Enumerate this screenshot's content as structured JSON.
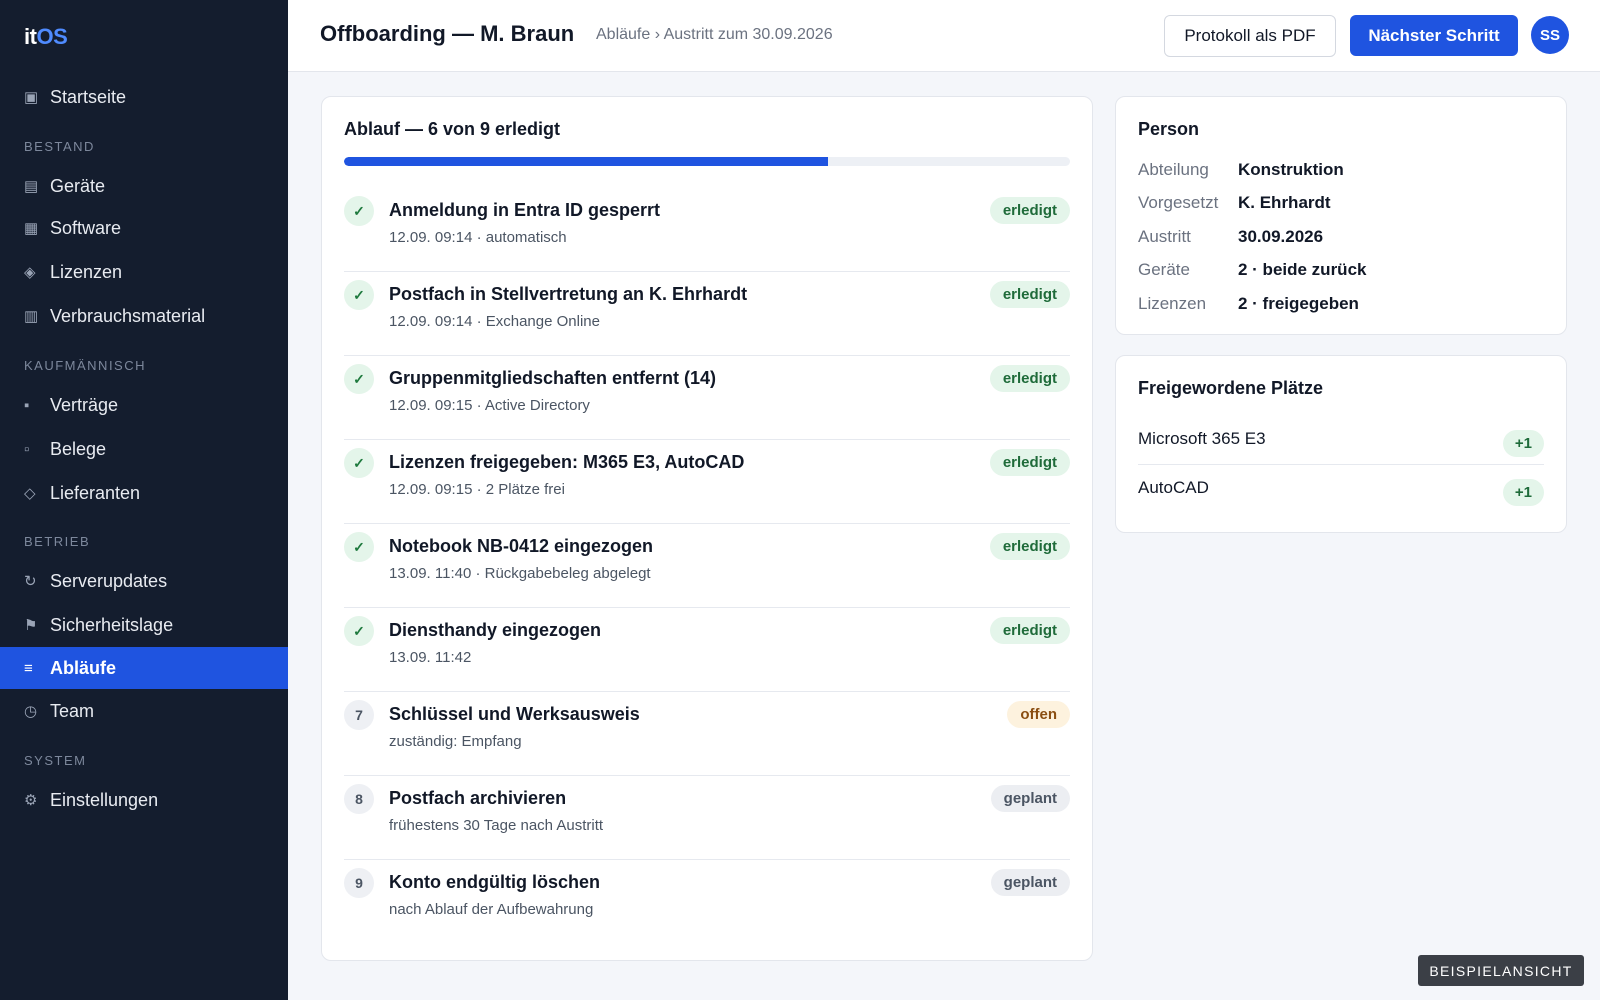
{
  "app": {
    "logo_it": "it",
    "logo_os": "OS"
  },
  "sidebar": {
    "home": {
      "label": "Startseite",
      "icon": "dashboard-icon"
    },
    "sections": [
      {
        "title": "BESTAND"
      },
      {
        "title": "KAUFMÄNNISCH"
      },
      {
        "title": "BETRIEB"
      },
      {
        "title": "SYSTEM"
      }
    ],
    "items": [
      {
        "label": "Geräte",
        "icon": "devices-icon"
      },
      {
        "label": "Software",
        "icon": "software-icon"
      },
      {
        "label": "Lizenzen",
        "icon": "license-icon"
      },
      {
        "label": "Verbrauchsmaterial",
        "icon": "supplies-icon"
      },
      {
        "label": "Verträge",
        "icon": "contracts-icon"
      },
      {
        "label": "Belege",
        "icon": "receipts-icon"
      },
      {
        "label": "Lieferanten",
        "icon": "suppliers-icon"
      },
      {
        "label": "Serverupdates",
        "icon": "refresh-icon"
      },
      {
        "label": "Sicherheitslage",
        "icon": "flag-icon"
      },
      {
        "label": "Abläufe",
        "icon": "list-icon",
        "active": true
      },
      {
        "label": "Team",
        "icon": "clock-icon"
      },
      {
        "label": "Einstellungen",
        "icon": "gear-icon"
      }
    ]
  },
  "header": {
    "title": "Offboarding — M. Braun",
    "breadcrumb": "Abläufe › Austritt zum 30.09.2026",
    "pdf_button": "Protokoll als PDF",
    "next_button": "Nächster Schritt",
    "avatar": "SS"
  },
  "workflow": {
    "title": "Ablauf — 6 von 9 erledigt",
    "progress": 0.667,
    "steps": [
      {
        "marker": "✓",
        "status": "done",
        "title": "Anmeldung in Entra ID gesperrt",
        "meta": "12.09. 09:14 · automatisch",
        "badge": "erledigt"
      },
      {
        "marker": "✓",
        "status": "done",
        "title": "Postfach in Stellvertretung an K. Ehrhardt",
        "meta": "12.09. 09:14 · Exchange Online",
        "badge": "erledigt"
      },
      {
        "marker": "✓",
        "status": "done",
        "title": "Gruppenmitgliedschaften entfernt (14)",
        "meta": "12.09. 09:15 · Active Directory",
        "badge": "erledigt"
      },
      {
        "marker": "✓",
        "status": "done",
        "title": "Lizenzen freigegeben: M365 E3, AutoCAD",
        "meta": "12.09. 09:15 · 2 Plätze frei",
        "badge": "erledigt"
      },
      {
        "marker": "✓",
        "status": "done",
        "title": "Notebook NB-0412 eingezogen",
        "meta": "13.09. 11:40 · Rückgabebeleg abgelegt",
        "badge": "erledigt"
      },
      {
        "marker": "✓",
        "status": "done",
        "title": "Diensthandy eingezogen",
        "meta": "13.09. 11:42",
        "badge": "erledigt"
      },
      {
        "marker": "7",
        "status": "open",
        "title": "Schlüssel und Werksausweis",
        "meta": "zuständig: Empfang",
        "badge": "offen"
      },
      {
        "marker": "8",
        "status": "planned",
        "title": "Postfach archivieren",
        "meta": "frühestens 30 Tage nach Austritt",
        "badge": "geplant"
      },
      {
        "marker": "9",
        "status": "planned",
        "title": "Konto endgültig löschen",
        "meta": "nach Ablauf der Aufbewahrung",
        "badge": "geplant"
      }
    ]
  },
  "person": {
    "title": "Person",
    "rows": [
      {
        "label": "Abteilung",
        "value": "Konstruktion"
      },
      {
        "label": "Vorgesetzt",
        "value": "K. Ehrhardt"
      },
      {
        "label": "Austritt",
        "value": "30.09.2026"
      },
      {
        "label": "Geräte",
        "value": "2 · beide zurück"
      },
      {
        "label": "Lizenzen",
        "value": "2 · freigegeben"
      }
    ]
  },
  "seats": {
    "title": "Freigewordene Plätze",
    "rows": [
      {
        "name": "Microsoft 365 E3",
        "delta": "+1"
      },
      {
        "name": "AutoCAD",
        "delta": "+1"
      }
    ]
  },
  "footer_tag": "BEISPIELANSICHT",
  "colors": {
    "accent": "#1f54e0",
    "sidebar": "#141d2e",
    "done": "#1f6b3a",
    "open": "#8a4e12"
  }
}
